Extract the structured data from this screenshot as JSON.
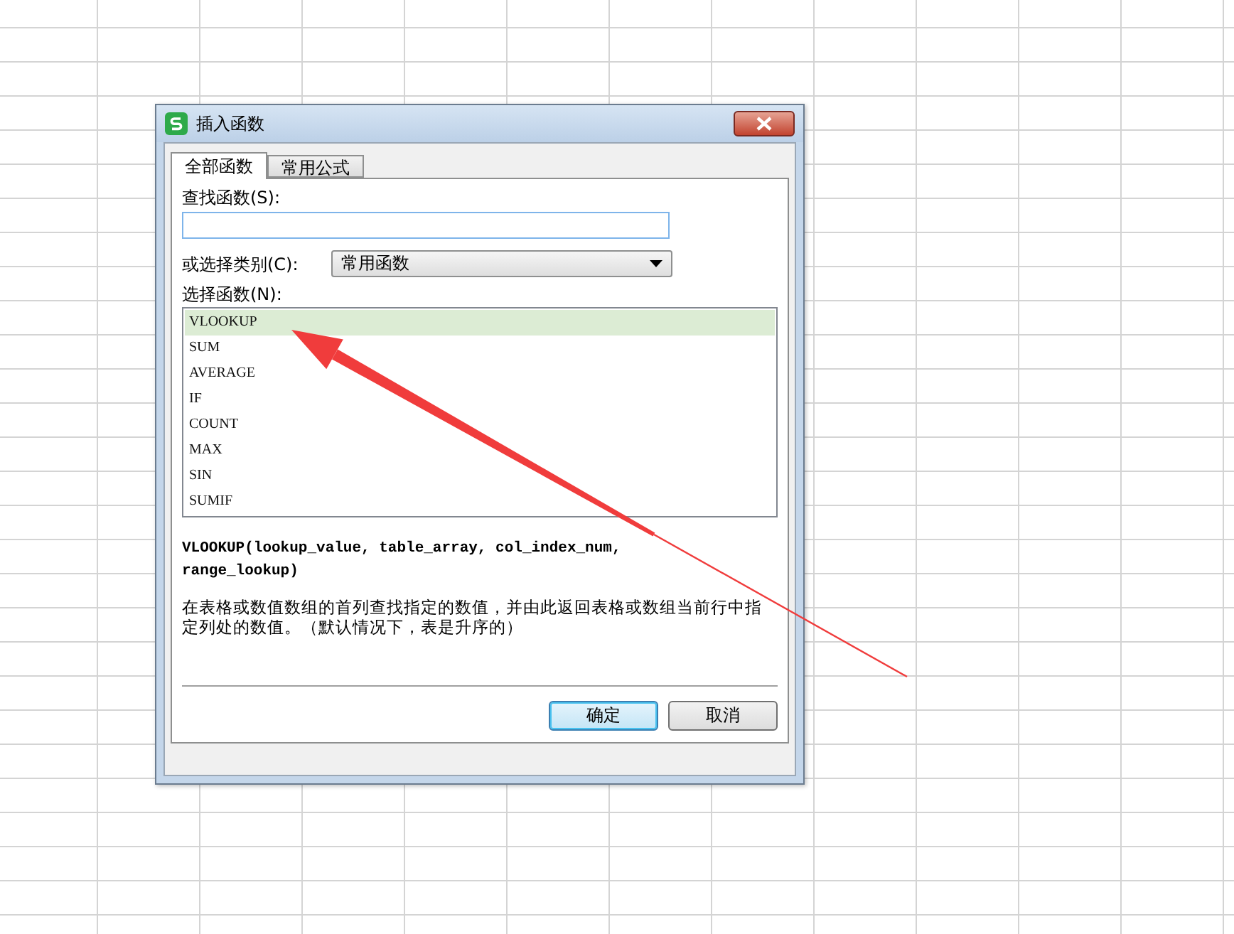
{
  "window": {
    "title": "插入函数"
  },
  "tabs": [
    {
      "label": "全部函数",
      "selected": true
    },
    {
      "label": "常用公式",
      "selected": false
    }
  ],
  "search": {
    "label": "查找函数(S):"
  },
  "category": {
    "label": "或选择类别(C):",
    "value": "常用函数"
  },
  "function_list": {
    "label": "选择函数(N):",
    "items": [
      {
        "name": "VLOOKUP",
        "selected": true
      },
      {
        "name": "SUM",
        "selected": false
      },
      {
        "name": "AVERAGE",
        "selected": false
      },
      {
        "name": "IF",
        "selected": false
      },
      {
        "name": "COUNT",
        "selected": false
      },
      {
        "name": "MAX",
        "selected": false
      },
      {
        "name": "SIN",
        "selected": false
      },
      {
        "name": "SUMIF",
        "selected": false
      }
    ]
  },
  "signature": "VLOOKUP(lookup_value, table_array, col_index_num, range_lookup)",
  "description": "在表格或数值数组的首列查找指定的数值，并由此返回表格或数组当前行中指定列处的数值。（默认情况下，表是升序的）",
  "buttons": [
    {
      "label": "确定",
      "kind": "primary"
    },
    {
      "label": "取消",
      "kind": "default"
    }
  ]
}
